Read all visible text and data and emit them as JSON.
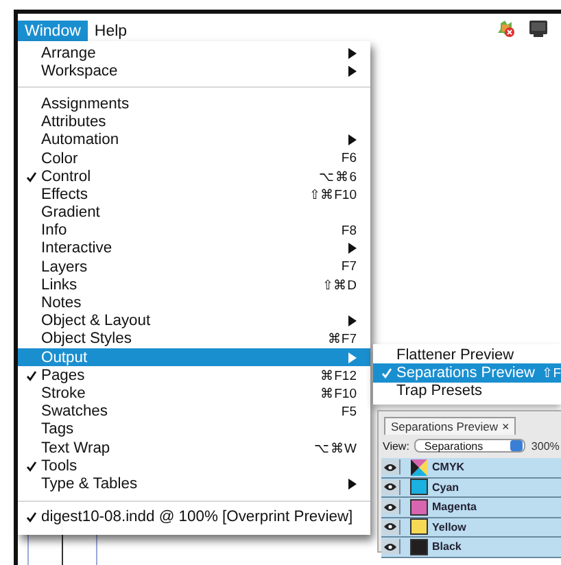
{
  "menu_bar": [
    {
      "label": "Window",
      "selected": true
    },
    {
      "label": "Help",
      "selected": false
    }
  ],
  "menu": [
    {
      "kind": "item",
      "label": "Arrange",
      "submenu": true,
      "checked": false,
      "selected": false
    },
    {
      "kind": "item",
      "label": "Workspace",
      "submenu": true,
      "checked": false,
      "selected": false
    },
    {
      "kind": "separator"
    },
    {
      "kind": "item",
      "label": "Assignments",
      "submenu": false,
      "checked": false,
      "selected": false
    },
    {
      "kind": "item",
      "label": "Attributes",
      "submenu": false,
      "checked": false,
      "selected": false
    },
    {
      "kind": "item",
      "label": "Automation",
      "submenu": true,
      "checked": false,
      "selected": false
    },
    {
      "kind": "item",
      "label": "Color",
      "shortcut": "F6",
      "submenu": false,
      "checked": false,
      "selected": false
    },
    {
      "kind": "item",
      "label": "Control",
      "shortcut": "⌥⌘6",
      "submenu": false,
      "checked": true,
      "selected": false
    },
    {
      "kind": "item",
      "label": "Effects",
      "shortcut": "⇧⌘F10",
      "submenu": false,
      "checked": false,
      "selected": false
    },
    {
      "kind": "item",
      "label": "Gradient",
      "submenu": false,
      "checked": false,
      "selected": false
    },
    {
      "kind": "item",
      "label": "Info",
      "shortcut": "F8",
      "submenu": false,
      "checked": false,
      "selected": false
    },
    {
      "kind": "item",
      "label": "Interactive",
      "submenu": true,
      "checked": false,
      "selected": false
    },
    {
      "kind": "item",
      "label": "Layers",
      "shortcut": "F7",
      "submenu": false,
      "checked": false,
      "selected": false
    },
    {
      "kind": "item",
      "label": "Links",
      "shortcut": "⇧⌘D",
      "submenu": false,
      "checked": false,
      "selected": false
    },
    {
      "kind": "item",
      "label": "Notes",
      "submenu": false,
      "checked": false,
      "selected": false
    },
    {
      "kind": "item",
      "label": "Object & Layout",
      "submenu": true,
      "checked": false,
      "selected": false
    },
    {
      "kind": "item",
      "label": "Object Styles",
      "shortcut": "⌘F7",
      "submenu": false,
      "checked": false,
      "selected": false
    },
    {
      "kind": "item",
      "label": "Output",
      "submenu": true,
      "checked": false,
      "selected": true
    },
    {
      "kind": "item",
      "label": "Pages",
      "shortcut": "⌘F12",
      "submenu": false,
      "checked": true,
      "selected": false
    },
    {
      "kind": "item",
      "label": "Stroke",
      "shortcut": "⌘F10",
      "submenu": false,
      "checked": false,
      "selected": false
    },
    {
      "kind": "item",
      "label": "Swatches",
      "shortcut": "F5",
      "submenu": false,
      "checked": false,
      "selected": false
    },
    {
      "kind": "item",
      "label": "Tags",
      "submenu": false,
      "checked": false,
      "selected": false
    },
    {
      "kind": "item",
      "label": "Text Wrap",
      "shortcut": "⌥⌘W",
      "submenu": false,
      "checked": false,
      "selected": false
    },
    {
      "kind": "item",
      "label": "Tools",
      "submenu": false,
      "checked": true,
      "selected": false
    },
    {
      "kind": "item",
      "label": "Type & Tables",
      "submenu": true,
      "checked": false,
      "selected": false
    },
    {
      "kind": "separator"
    },
    {
      "kind": "item",
      "label": "digest10-08.indd @ 100% [Overprint Preview]",
      "submenu": false,
      "checked": true,
      "selected": false
    }
  ],
  "submenu": [
    {
      "label": "Flattener Preview",
      "checked": false,
      "selected": false
    },
    {
      "label": "Separations Preview",
      "shortcut": "⇧F",
      "checked": true,
      "selected": true
    },
    {
      "label": "Trap Presets",
      "checked": false,
      "selected": false
    }
  ],
  "panel": {
    "tab": "Separations Preview",
    "close": "×",
    "view_label": "View:",
    "view_value": "Separations",
    "zoom": "300%",
    "rows": [
      {
        "kind": "composite",
        "name": "CMYK",
        "visible": true
      },
      {
        "kind": "ink",
        "name": "Cyan",
        "color": "#1ab0e0",
        "visible": true
      },
      {
        "kind": "ink",
        "name": "Magenta",
        "color": "#d865b0",
        "visible": true
      },
      {
        "kind": "ink",
        "name": "Yellow",
        "color": "#f6d955",
        "visible": true
      },
      {
        "kind": "ink",
        "name": "Black",
        "color": "#231f20",
        "visible": true
      }
    ]
  }
}
